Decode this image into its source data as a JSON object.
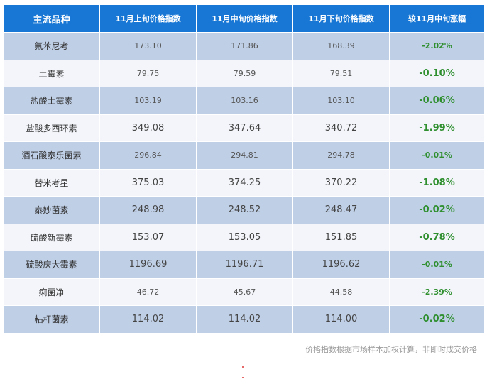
{
  "table": {
    "headers": [
      "主流品种",
      "11月上旬价格指数",
      "11月中旬价格指数",
      "11月下旬价格指数",
      "较11月中旬涨幅"
    ],
    "rows": [
      {
        "name": "氟苯尼考",
        "early": "173.10",
        "mid": "171.86",
        "late": "168.39",
        "change": "-2.02%"
      },
      {
        "name": "土霉素",
        "early": "79.75",
        "mid": "79.59",
        "late": "79.51",
        "change": "-0.10%"
      },
      {
        "name": "盐酸土霉素",
        "early": "103.19",
        "mid": "103.16",
        "late": "103.10",
        "change": "-0.06%"
      },
      {
        "name": "盐酸多西环素",
        "early": "349.08",
        "mid": "347.64",
        "late": "340.72",
        "change": "-1.99%"
      },
      {
        "name": "酒石酸泰乐菌素",
        "early": "296.84",
        "mid": "294.81",
        "late": "294.78",
        "change": "-0.01%"
      },
      {
        "name": "替米考星",
        "early": "375.03",
        "mid": "374.25",
        "late": "370.22",
        "change": "-1.08%"
      },
      {
        "name": "泰妙菌素",
        "early": "248.98",
        "mid": "248.52",
        "late": "248.47",
        "change": "-0.02%"
      },
      {
        "name": "硫酸新霉素",
        "early": "153.07",
        "mid": "153.05",
        "late": "151.85",
        "change": "-0.78%"
      },
      {
        "name": "硫酸庆大霉素",
        "early": "1196.69",
        "mid": "1196.71",
        "late": "1196.62",
        "change": "-0.01%"
      },
      {
        "name": "痢菌净",
        "early": "46.72",
        "mid": "45.67",
        "late": "44.58",
        "change": "-2.39%"
      },
      {
        "name": "粘杆菌素",
        "early": "114.02",
        "mid": "114.02",
        "late": "114.00",
        "change": "-0.02%"
      }
    ]
  },
  "footnote": "价格指数根据市场样本加权计算，非即时成交价格",
  "colors": {
    "header_bg": "#1877d4",
    "row_shaded": "#bfcfe6",
    "row_plain": "#f3f5fa",
    "change_text": "#2f8f2f"
  }
}
